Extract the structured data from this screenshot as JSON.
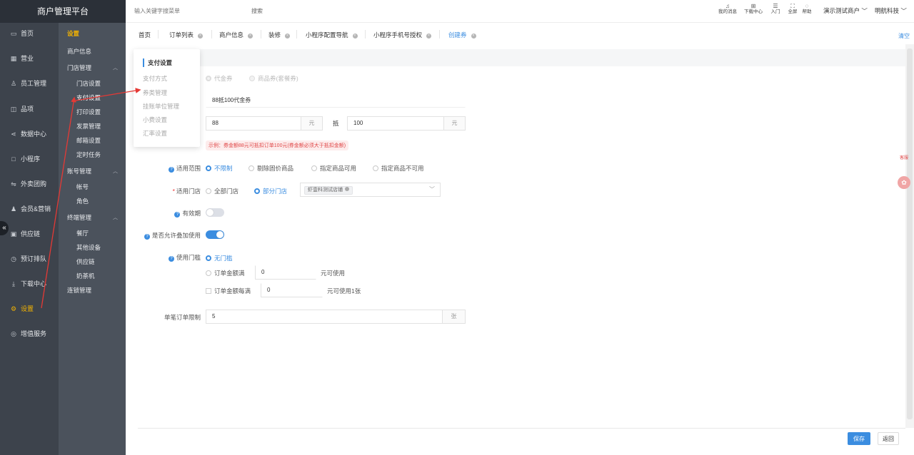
{
  "brand": "商户管理平台",
  "sidebar": {
    "items": [
      {
        "label": "首页",
        "icon": "screen-icon"
      },
      {
        "label": "营业",
        "icon": "calendar-icon"
      },
      {
        "label": "员工管理",
        "icon": "user-icon"
      },
      {
        "label": "品项",
        "icon": "bag-icon"
      },
      {
        "label": "数据中心",
        "icon": "share-icon"
      },
      {
        "label": "小程序",
        "icon": "miniapp-icon"
      },
      {
        "label": "外卖团购",
        "icon": "delivery-icon"
      },
      {
        "label": "会员&营销",
        "icon": "member-icon"
      },
      {
        "label": "供应链",
        "icon": "truck-icon"
      },
      {
        "label": "预订排队",
        "icon": "clock-icon"
      },
      {
        "label": "下载中心",
        "icon": "download-icon"
      },
      {
        "label": "设置",
        "icon": "gear-icon"
      },
      {
        "label": "增值服务",
        "icon": "service-icon"
      }
    ],
    "collapse": "«"
  },
  "submenu": {
    "title": "设置",
    "merchant_info": "商户信息",
    "store_mgmt": "门店管理",
    "store_settings": "门店设置",
    "payment_settings": "支付设置",
    "print_settings": "打印设置",
    "invoice_mgmt": "发票管理",
    "email_settings": "邮箱设置",
    "timed_tasks": "定时任务",
    "account_mgmt": "账号管理",
    "account": "帐号",
    "role": "角色",
    "terminal_mgmt": "终端管理",
    "hall": "餐厅",
    "other_devices": "其他设备",
    "supply_chain": "供应链",
    "tea_machine": "奶茶机",
    "chain_mgmt": "连锁管理"
  },
  "topbar": {
    "search_placeholder": "输入关键字搜菜单",
    "search_btn": "搜索",
    "tools": [
      "我的消息",
      "下载中心",
      "入门",
      "全屏",
      "帮助"
    ],
    "account": "演示测试商户",
    "user": "明航科技"
  },
  "tabs": {
    "items": [
      "首页",
      "订单列表",
      "商户信息",
      "装修",
      "小程序配置导航",
      "小程序手机号授权",
      "创建券"
    ],
    "clear": "清空"
  },
  "popup": {
    "title": "支付设置",
    "items": [
      "支付方式",
      "券类管理",
      "挂账单位管理",
      "小费设置",
      "汇率设置"
    ]
  },
  "form": {
    "coupon_type_opt1": "代金券",
    "coupon_type_opt2": "商品券(套餐券)",
    "coupon_name": "88抵100代金券",
    "face_value": "88",
    "unit_yuan": "元",
    "deduct_label": "抵",
    "deduct_value": "100",
    "tip": "示例：券金额88元可抵扣订单100元(券金额必须大于抵扣金额)",
    "scope_label": "适用范围",
    "scope_opts": [
      "不限制",
      "剔除固价商品",
      "指定商品可用",
      "指定商品不可用"
    ],
    "stores_label": "适用门店",
    "stores_opts": [
      "全部门店",
      "部分门店"
    ],
    "store_tag": "虾壹科测试店铺",
    "validity_label": "有效期",
    "stack_label": "是否允许叠加使用",
    "threshold_label": "使用门槛",
    "threshold_none": "无门槛",
    "threshold_full": "订单金额满",
    "threshold_full_value": "0",
    "threshold_full_suffix": "元可使用",
    "threshold_each": "订单金额每满",
    "threshold_each_value": "0",
    "threshold_each_suffix": "元可使用1张",
    "limit_label": "单笔订单限制",
    "limit_value": "5",
    "unit_zhang": "张"
  },
  "footer": {
    "save": "保存",
    "back": "返回"
  },
  "floating": {
    "badge": "客服"
  },
  "colors": {
    "accent": "#3b8de0",
    "sidebar_bg": "#3d434c",
    "submenu_bg": "#4b525c",
    "active_menu": "#f5b400",
    "warning": "#e04646",
    "arrow": "#e53935"
  }
}
